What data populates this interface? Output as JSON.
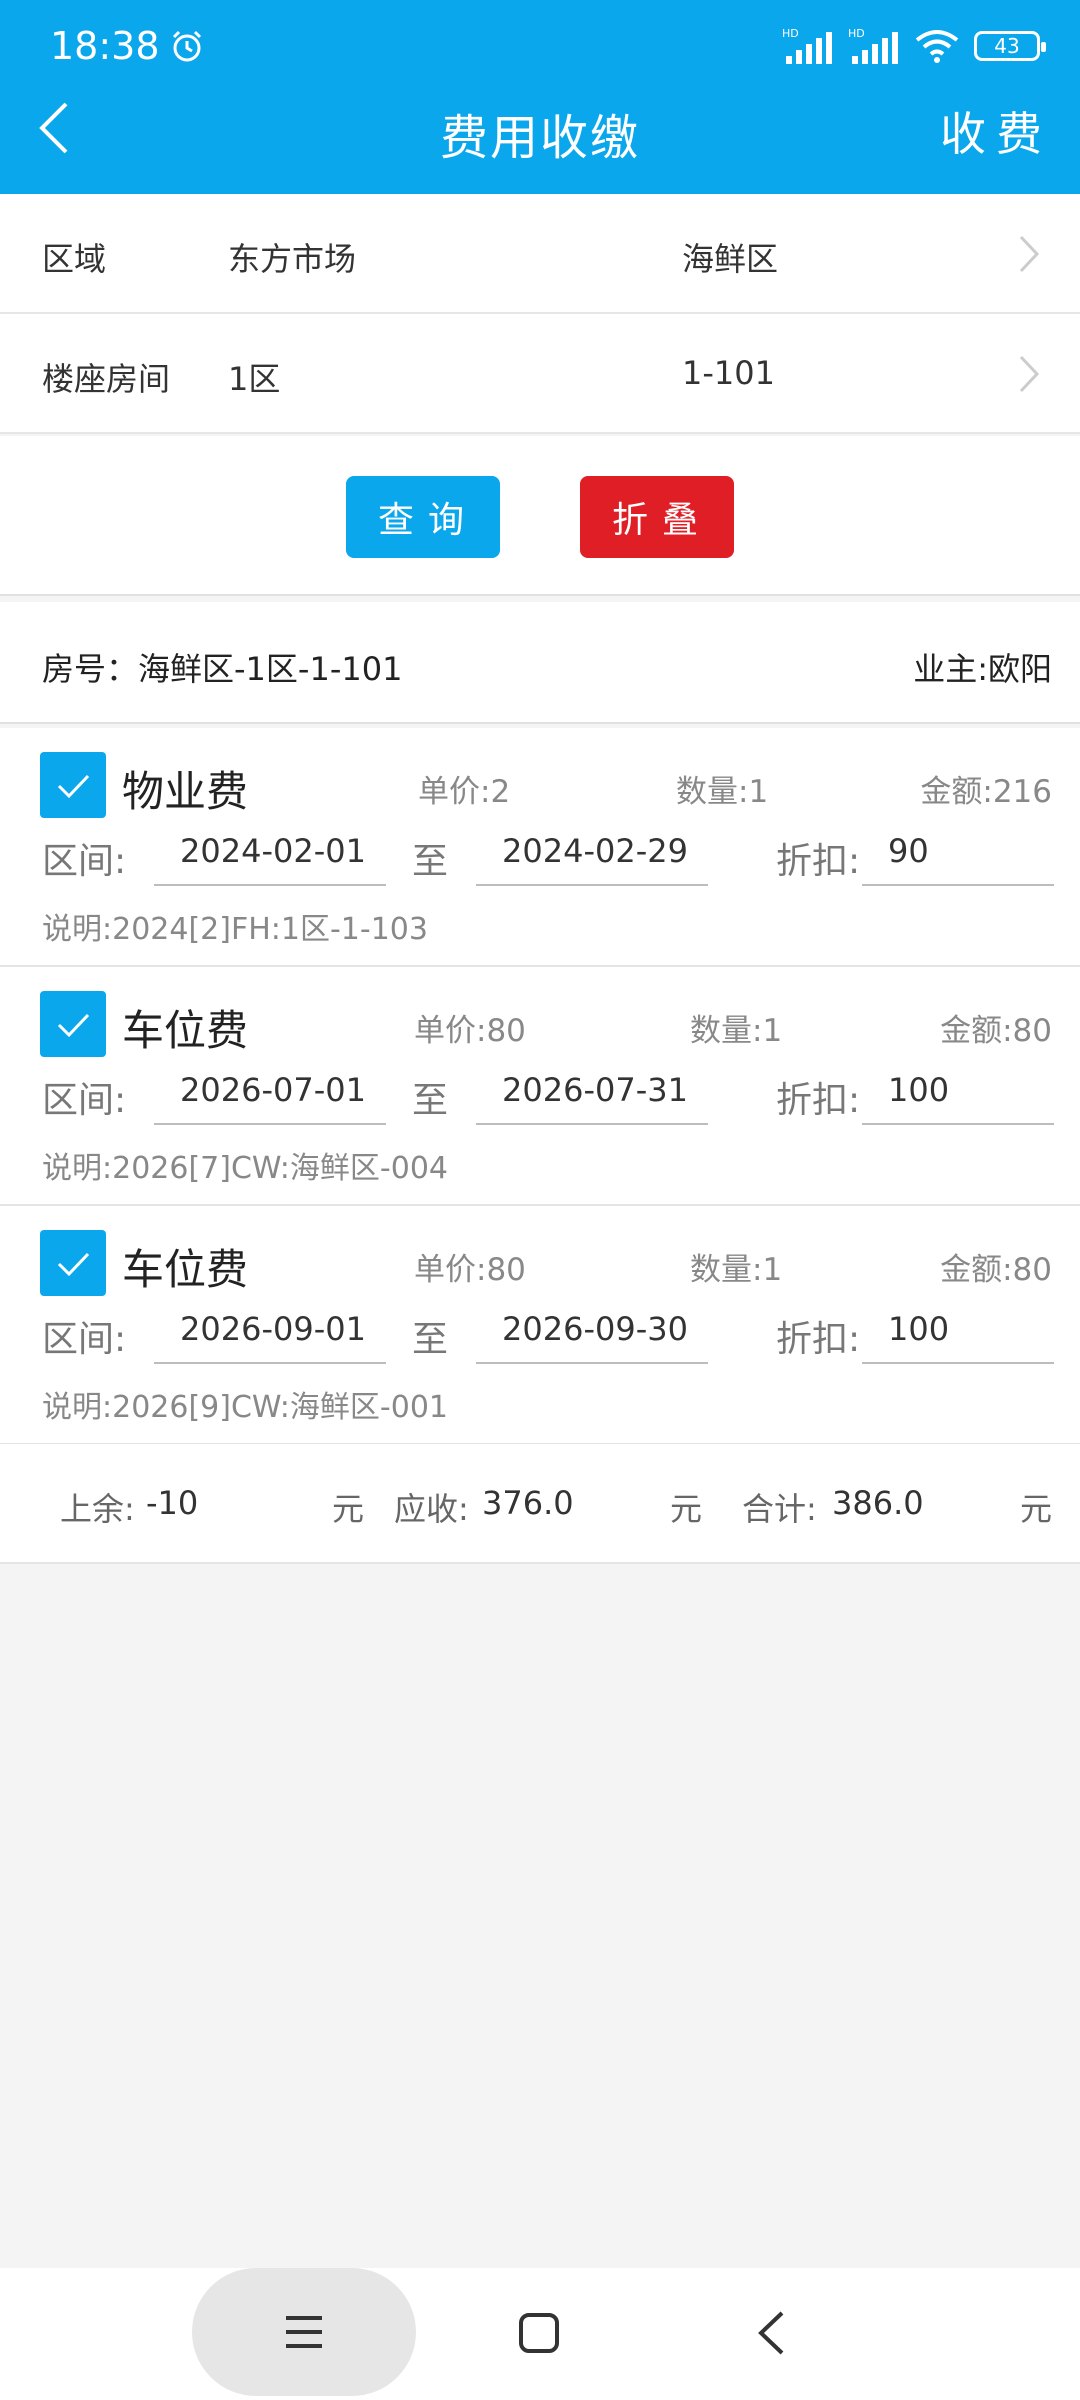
{
  "status_bar": {
    "time": "18:38",
    "battery": "43",
    "hd1": "HD",
    "hd2": "HD"
  },
  "header": {
    "title": "费用收缴",
    "action": "收费"
  },
  "selectors": [
    {
      "label": "区域",
      "value1": "东方市场",
      "value2": "海鲜区"
    },
    {
      "label": "楼座房间",
      "value1": "1区",
      "value2": "1-101"
    }
  ],
  "buttons": {
    "query": "查询",
    "fold": "折叠"
  },
  "room_info": {
    "room": "房号：海鲜区-1区-1-101",
    "owner": "业主:欧阳"
  },
  "fees": [
    {
      "name": "物业费",
      "price": "单价:2",
      "qty": "数量:1",
      "amount": "金额:216",
      "range_label": "区间:",
      "from": "2024-02-01",
      "to_label": "至",
      "to": "2024-02-29",
      "discount_label": "折扣:",
      "discount": "90",
      "note": "说明:2024[2]FH:1区-1-103",
      "checked": true
    },
    {
      "name": "车位费",
      "price": "单价:80",
      "qty": "数量:1",
      "amount": "金额:80",
      "range_label": "区间:",
      "from": "2026-07-01",
      "to_label": "至",
      "to": "2026-07-31",
      "discount_label": "折扣:",
      "discount": "100",
      "note": "说明:2026[7]CW:海鲜区-004",
      "checked": true
    },
    {
      "name": "车位费",
      "price": "单价:80",
      "qty": "数量:1",
      "amount": "金额:80",
      "range_label": "区间:",
      "from": "2026-09-01",
      "to_label": "至",
      "to": "2026-09-30",
      "discount_label": "折扣:",
      "discount": "100",
      "note": "说明:2026[9]CW:海鲜区-001",
      "checked": true
    }
  ],
  "summary": {
    "balance_label": "上余:",
    "balance": "-10",
    "unit1": "元",
    "receivable_label": "应收:",
    "receivable": "376.0",
    "unit2": "元",
    "total_label": "合计:",
    "total": "386.0",
    "unit3": "元"
  },
  "colors": {
    "primary": "#0aa7ec",
    "danger": "#e01e26"
  },
  "icons": [
    "alarm-icon",
    "signal-icon",
    "wifi-icon",
    "battery-icon",
    "back-icon",
    "chevron-right-icon",
    "checkbox-checked-icon",
    "menu-icon",
    "home-icon",
    "nav-back-icon"
  ]
}
